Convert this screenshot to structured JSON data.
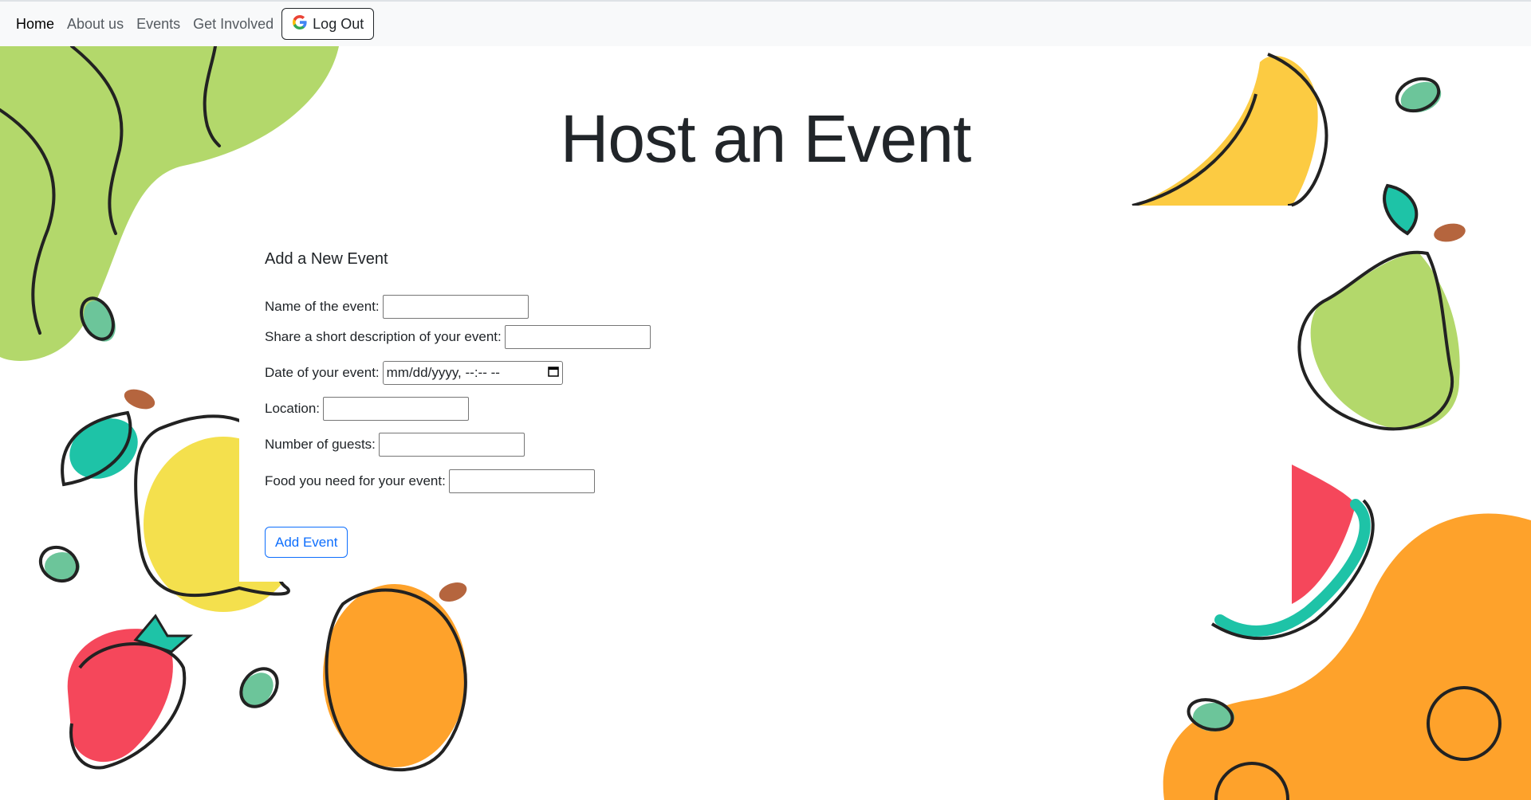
{
  "nav": {
    "home": "Home",
    "about": "About us",
    "events": "Events",
    "get_involved": "Get Involved",
    "logout": "Log Out",
    "logout_icon": "google-g-icon"
  },
  "page": {
    "title": "Host an Event"
  },
  "form": {
    "title": "Add a New Event",
    "name_label": "Name of the event:",
    "description_label": "Share a short description of your event:",
    "date_label": "Date of your event:",
    "date_placeholder": "mm/dd/yyyy, --:-- --",
    "date_icon": "calendar-icon",
    "location_label": "Location:",
    "guests_label": "Number of guests:",
    "food_label": "Food you need for your event:",
    "submit_label": "Add Event"
  },
  "colors": {
    "navbar_bg": "#f8f9fa",
    "primary": "#0d6efd",
    "green_blob": "#b3d86b",
    "orange_blob": "#fea22b",
    "banana": "#fccb42",
    "lemon": "#f4e04d",
    "strawberry": "#f5475b",
    "teal_leaf": "#1ec3a7"
  }
}
